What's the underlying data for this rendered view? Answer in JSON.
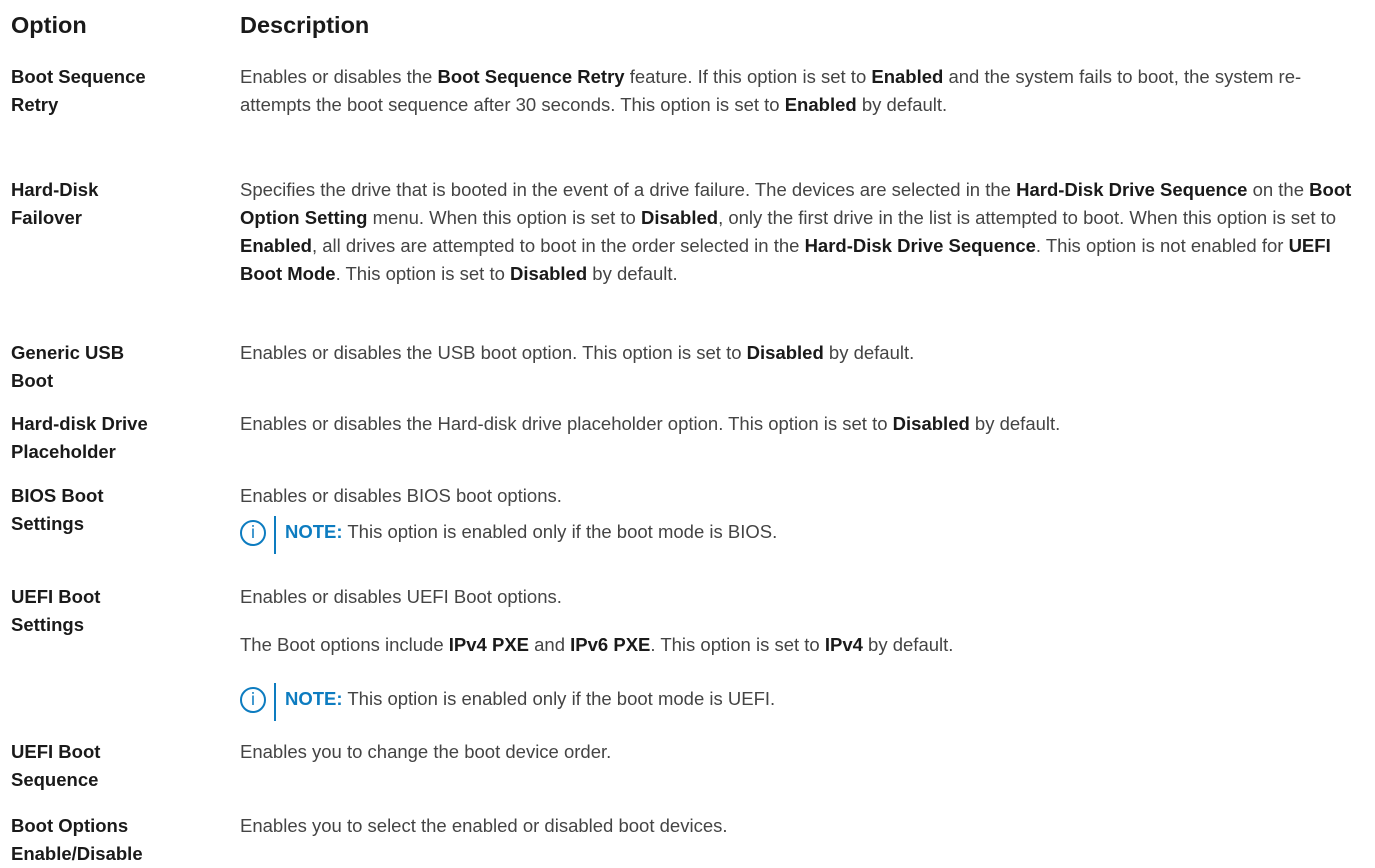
{
  "header": {
    "option": "Option",
    "description": "Description"
  },
  "rows": [
    {
      "option_lines": [
        "Boot Sequence",
        "Retry"
      ],
      "desc": [
        "Enables or disables the ",
        {
          "b": "Boot Sequence Retry"
        },
        " feature. If this option is set to ",
        {
          "b": "Enabled"
        },
        " and the system fails to boot, the system re-attempts the boot sequence after 30 seconds. This option is set to ",
        {
          "b": "Enabled"
        },
        " by default."
      ]
    },
    {
      "option_lines": [
        "Hard-Disk",
        "Failover"
      ],
      "desc": [
        "Specifies the drive that is booted in the event of a drive failure. The devices are selected in the ",
        {
          "b": "Hard-Disk Drive Sequence"
        },
        " on the ",
        {
          "b": "Boot Option Setting"
        },
        " menu. When this option is set to ",
        {
          "b": "Disabled"
        },
        ", only the first drive in the list is attempted to boot. When this option is set to ",
        {
          "b": "Enabled"
        },
        ", all drives are attempted to boot in the order selected in the ",
        {
          "b": "Hard-Disk Drive Sequence"
        },
        ". This option is not enabled for ",
        {
          "b": "UEFI Boot Mode"
        },
        ". This option is set to ",
        {
          "b": "Disabled"
        },
        " by default."
      ]
    },
    {
      "option_lines": [
        "Generic USB",
        "Boot"
      ],
      "desc": [
        "Enables or disables the USB boot option. This option is set to ",
        {
          "b": "Disabled"
        },
        " by default."
      ]
    },
    {
      "option_lines": [
        "Hard-disk Drive",
        "Placeholder"
      ],
      "desc": [
        "Enables or disables the Hard-disk drive placeholder option. This option is set to ",
        {
          "b": "Disabled"
        },
        " by default."
      ]
    },
    {
      "option_lines": [
        "BIOS Boot",
        "Settings"
      ],
      "desc": [
        "Enables or disables BIOS boot options."
      ],
      "note": {
        "label": "NOTE:",
        "text": " This option is enabled only if the boot mode is BIOS."
      }
    },
    {
      "option_lines": [
        "UEFI Boot",
        "Settings"
      ],
      "desc": [
        "Enables or disables UEFI Boot options."
      ],
      "desc2": [
        "The Boot options include ",
        {
          "b": "IPv4 PXE"
        },
        " and ",
        {
          "b": "IPv6 PXE"
        },
        ". This option is set to ",
        {
          "b": "IPv4"
        },
        " by default."
      ],
      "note": {
        "label": "NOTE:",
        "text": " This option is enabled only if the boot mode is UEFI."
      }
    },
    {
      "option_lines": [
        "UEFI Boot",
        "Sequence"
      ],
      "desc": [
        "Enables you to change the boot device order."
      ]
    },
    {
      "option_lines": [
        "Boot Options",
        "Enable/Disable"
      ],
      "desc": [
        "Enables you to select the enabled or disabled boot devices."
      ]
    }
  ],
  "icons": {
    "note_icon": "info-circle-icon",
    "note_color": "#0d7cc0"
  }
}
